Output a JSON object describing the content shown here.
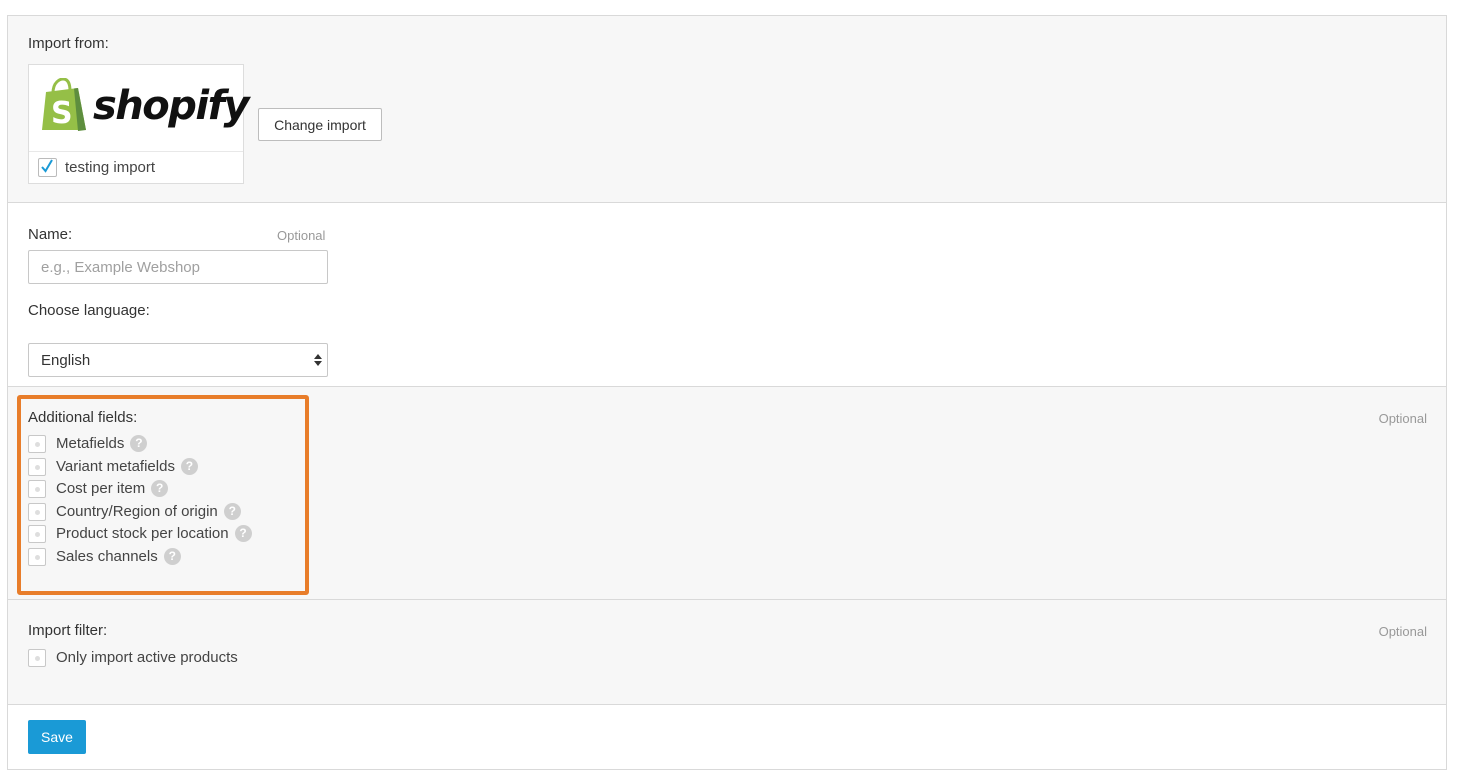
{
  "import_from": {
    "label": "Import from:",
    "source_logo_text": "shopify",
    "source_logo_icon": "shopify-bag-icon",
    "import_name": "testing import",
    "import_checked": true,
    "change_button": "Change import"
  },
  "name_field": {
    "label": "Name:",
    "optional": "Optional",
    "placeholder": "e.g., Example Webshop",
    "value": ""
  },
  "language": {
    "label": "Choose language:",
    "selected": "English"
  },
  "additional_fields": {
    "label": "Additional fields:",
    "optional": "Optional",
    "highlight_color": "#e87d2a",
    "items": [
      {
        "label": "Metafields",
        "checked": false
      },
      {
        "label": "Variant metafields",
        "checked": false
      },
      {
        "label": "Cost per item",
        "checked": false
      },
      {
        "label": "Country/Region of origin",
        "checked": false
      },
      {
        "label": "Product stock per location",
        "checked": false
      },
      {
        "label": "Sales channels",
        "checked": false
      }
    ],
    "help_glyph": "?"
  },
  "import_filter": {
    "label": "Import filter:",
    "optional": "Optional",
    "items": [
      {
        "label": "Only import active products",
        "checked": false
      }
    ]
  },
  "save_button": "Save",
  "colors": {
    "accent": "#1a9ad6",
    "shopify_green": "#95bf47",
    "shopify_green_dark": "#5e8e3e",
    "checkmark": "#1a9ad6"
  }
}
